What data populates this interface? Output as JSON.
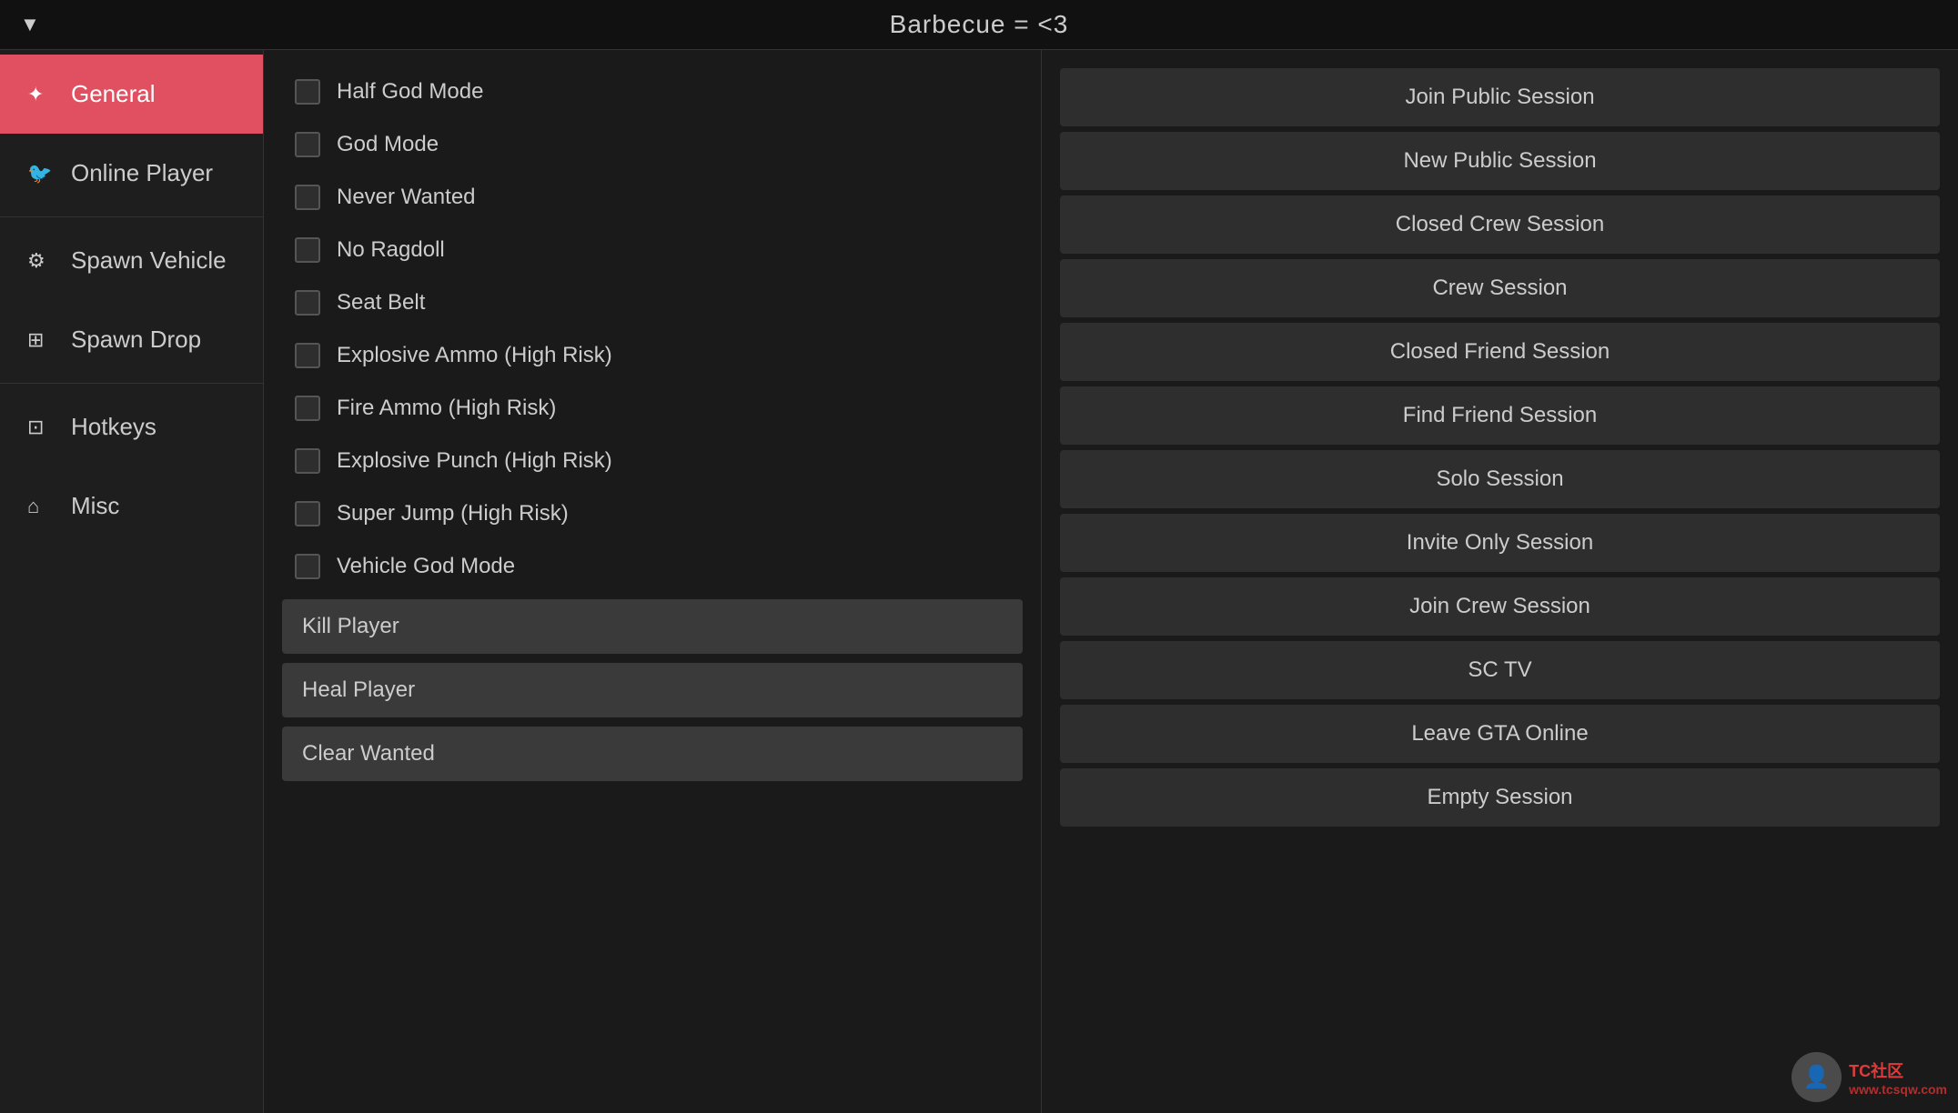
{
  "topbar": {
    "title": "Barbecue = <3",
    "arrow": "▼"
  },
  "sidebar": {
    "items": [
      {
        "id": "general",
        "icon": "⚙",
        "label": "General",
        "active": true,
        "icon_type": "gear-icon"
      },
      {
        "id": "online-player",
        "icon": "🐦",
        "label": "Online Player",
        "active": false,
        "icon_type": "bird-icon"
      },
      {
        "id": "spawn-vehicle",
        "icon": "⚙",
        "label": "Spawn Vehicle",
        "active": false,
        "icon_type": "gear-icon"
      },
      {
        "id": "spawn-drop",
        "icon": "🗂",
        "label": "Spawn Drop",
        "active": false,
        "icon_type": "box-icon"
      },
      {
        "id": "hotkeys",
        "icon": "🗂",
        "label": "Hotkeys",
        "active": false,
        "icon_type": "hotkeys-icon"
      },
      {
        "id": "misc",
        "icon": "🏠",
        "label": "Misc",
        "active": false,
        "icon_type": "misc-icon"
      }
    ]
  },
  "toggles": [
    {
      "label": "Half God Mode",
      "checked": false
    },
    {
      "label": "God Mode",
      "checked": false
    },
    {
      "label": "Never Wanted",
      "checked": false
    },
    {
      "label": "No Ragdoll",
      "checked": false
    },
    {
      "label": "Seat Belt",
      "checked": false
    },
    {
      "label": "Explosive Ammo (High Risk)",
      "checked": false
    },
    {
      "label": "Fire Ammo (High Risk)",
      "checked": false
    },
    {
      "label": "Explosive Punch (High Risk)",
      "checked": false
    },
    {
      "label": "Super Jump (High Risk)",
      "checked": false
    },
    {
      "label": "Vehicle God Mode",
      "checked": false
    }
  ],
  "action_buttons": [
    {
      "label": "Kill Player"
    },
    {
      "label": "Heal Player"
    },
    {
      "label": "Clear Wanted"
    }
  ],
  "session_buttons": [
    {
      "label": "Join Public Session"
    },
    {
      "label": "New Public Session"
    },
    {
      "label": "Closed Crew Session"
    },
    {
      "label": "Crew Session"
    },
    {
      "label": "Closed Friend Session"
    },
    {
      "label": "Find Friend Session"
    },
    {
      "label": "Solo Session"
    },
    {
      "label": "Invite Only Session"
    },
    {
      "label": "Join Crew Session"
    },
    {
      "label": "SC TV"
    },
    {
      "label": "Leave GTA Online"
    },
    {
      "label": "Empty Session"
    }
  ],
  "watermark": {
    "site": "TC社区",
    "url": "www.tcsqw.com"
  }
}
